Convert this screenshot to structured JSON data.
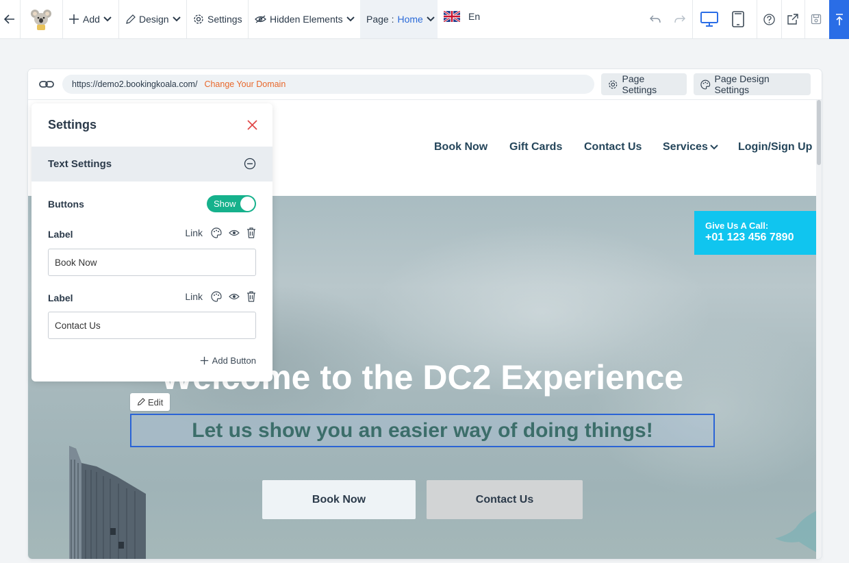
{
  "toolbar": {
    "add_label": "Add",
    "design_label": "Design",
    "settings_label": "Settings",
    "hidden_elements_label": "Hidden Elements",
    "page_prefix": "Page :",
    "page_value": "Home",
    "language_label": "En"
  },
  "url_bar": {
    "url": "https://demo2.bookingkoala.com/",
    "change_domain_label": "Change Your Domain",
    "page_settings_label": "Page Settings",
    "page_design_settings_label": "Page Design Settings"
  },
  "site_nav": {
    "items": [
      {
        "label": "Book Now"
      },
      {
        "label": "Gift Cards"
      },
      {
        "label": "Contact Us"
      },
      {
        "label": "Services"
      },
      {
        "label": "Login/Sign Up"
      }
    ]
  },
  "hero": {
    "call_label": "Give Us A Call:",
    "call_number": "+01 123 456 7890",
    "title": "Welcome to the DC2 Experience",
    "subtitle": "Let us show you an easier way of doing things!",
    "edit_label": "Edit",
    "primary_button": "Book Now",
    "secondary_button": "Contact Us"
  },
  "settings_panel": {
    "title": "Settings",
    "section_title": "Text Settings",
    "buttons_label": "Buttons",
    "toggle_label": "Show",
    "button_rows": [
      {
        "label": "Label",
        "link_label": "Link",
        "value": "Book Now"
      },
      {
        "label": "Label",
        "link_label": "Link",
        "value": "Contact Us"
      }
    ],
    "add_button_label": "Add Button"
  },
  "colors": {
    "accent_blue": "#2a6de6",
    "toggle_green": "#16b18c",
    "call_box_cyan": "#10c5ef",
    "domain_link_orange": "#e8672a",
    "close_red": "#e04848"
  },
  "icons": [
    "back-arrow-icon",
    "koala-logo",
    "plus-icon",
    "pencil-icon",
    "gear-icon",
    "eye-slash-icon",
    "chevron-down-icon",
    "uk-flag-icon",
    "undo-icon",
    "redo-icon",
    "desktop-icon",
    "tablet-icon",
    "help-icon",
    "external-link-icon",
    "save-icon",
    "arrow-to-top-icon",
    "link-icon",
    "palette-icon",
    "close-icon",
    "minus-circle-icon",
    "eye-icon",
    "trash-icon"
  ]
}
